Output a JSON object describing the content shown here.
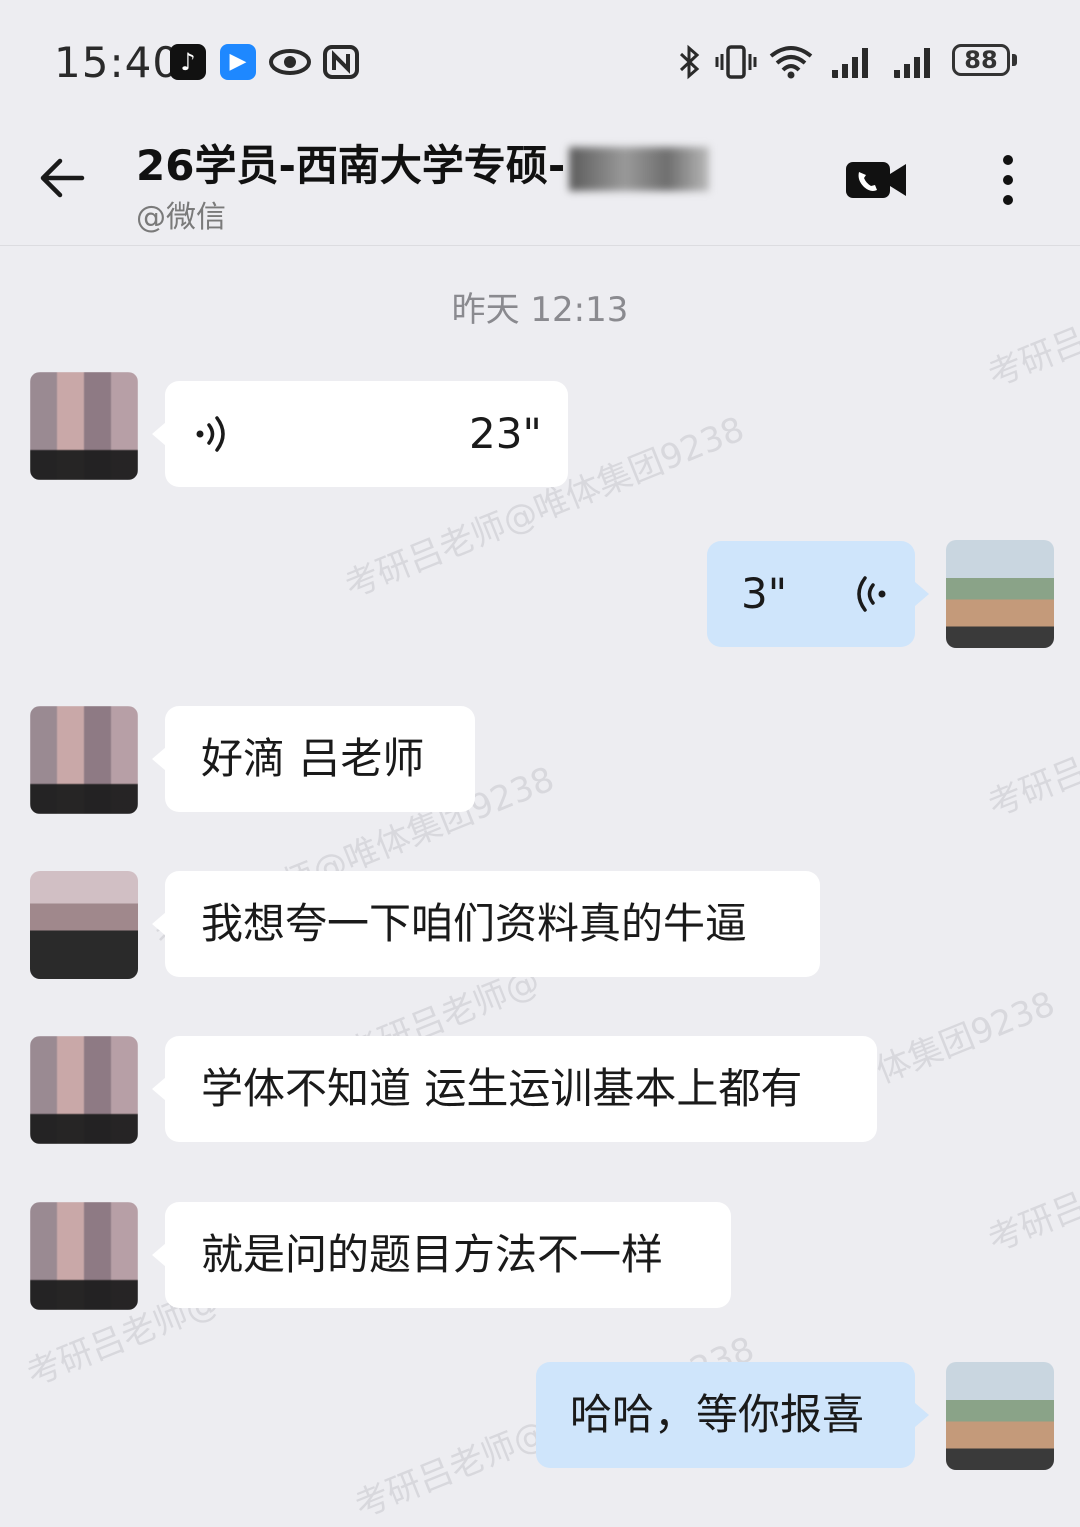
{
  "status_bar": {
    "time": "15:40",
    "battery": "88",
    "icons": [
      "tiktok-icon",
      "bilibili-icon",
      "eye-icon",
      "nfc-icon",
      "bluetooth-icon",
      "vibrate-icon",
      "wifi-icon",
      "signal-icon",
      "signal-icon",
      "battery-icon"
    ]
  },
  "header": {
    "title": "26学员-西南大学专硕-",
    "subtitle": "@微信",
    "icons": [
      "back-arrow-icon",
      "video-call-icon",
      "more-icon"
    ]
  },
  "watermark": [
    "考研吕老师@唯体集团9238",
    "考研吕",
    "考研吕老师@唯体集团9238",
    "考研吕",
    "考研吕",
    "考研吕老师@",
    "体集团9238",
    "考研吕老师@",
    "考研吕老师@唯体集团9238"
  ],
  "conversation": {
    "timestamp": "昨天 12:13",
    "messages": [
      {
        "side": "in",
        "type": "voice",
        "duration": "23\""
      },
      {
        "side": "out",
        "type": "voice",
        "duration": "3\""
      },
      {
        "side": "in",
        "type": "text",
        "text": "好滴 吕老师"
      },
      {
        "side": "in",
        "type": "text",
        "text": "我想夸一下咱们资料真的牛逼"
      },
      {
        "side": "in",
        "type": "text",
        "text": "学体不知道 运生运训基本上都有"
      },
      {
        "side": "in",
        "type": "text",
        "text": "就是问的题目方法不一样"
      },
      {
        "side": "out",
        "type": "text",
        "text": "哈哈，等你报喜"
      }
    ]
  }
}
